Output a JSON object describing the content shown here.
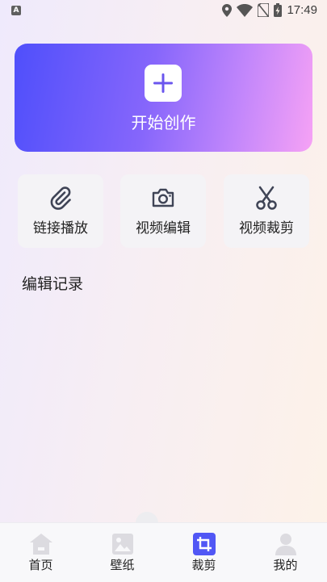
{
  "status_bar": {
    "app_badge": "A",
    "time": "17:49",
    "icons": [
      "location-icon",
      "wifi-icon",
      "no-sim-icon",
      "battery-charging-icon"
    ]
  },
  "create": {
    "label": "开始创作",
    "icon": "plus-icon"
  },
  "tools": [
    {
      "label": "链接播放",
      "icon": "paperclip-icon"
    },
    {
      "label": "视频编辑",
      "icon": "camera-icon"
    },
    {
      "label": "视频裁剪",
      "icon": "scissors-icon"
    }
  ],
  "history": {
    "title": "编辑记录"
  },
  "tabs": [
    {
      "label": "首页",
      "icon": "home-icon",
      "active": false
    },
    {
      "label": "壁纸",
      "icon": "image-icon",
      "active": false
    },
    {
      "label": "裁剪",
      "icon": "crop-icon",
      "active": true
    },
    {
      "label": "我的",
      "icon": "user-icon",
      "active": false
    }
  ],
  "colors": {
    "accent": "#5157f5",
    "gradient_start": "#4f4ffb",
    "gradient_end": "#f6a2f5",
    "tab_inactive": "#dcdbe0"
  }
}
